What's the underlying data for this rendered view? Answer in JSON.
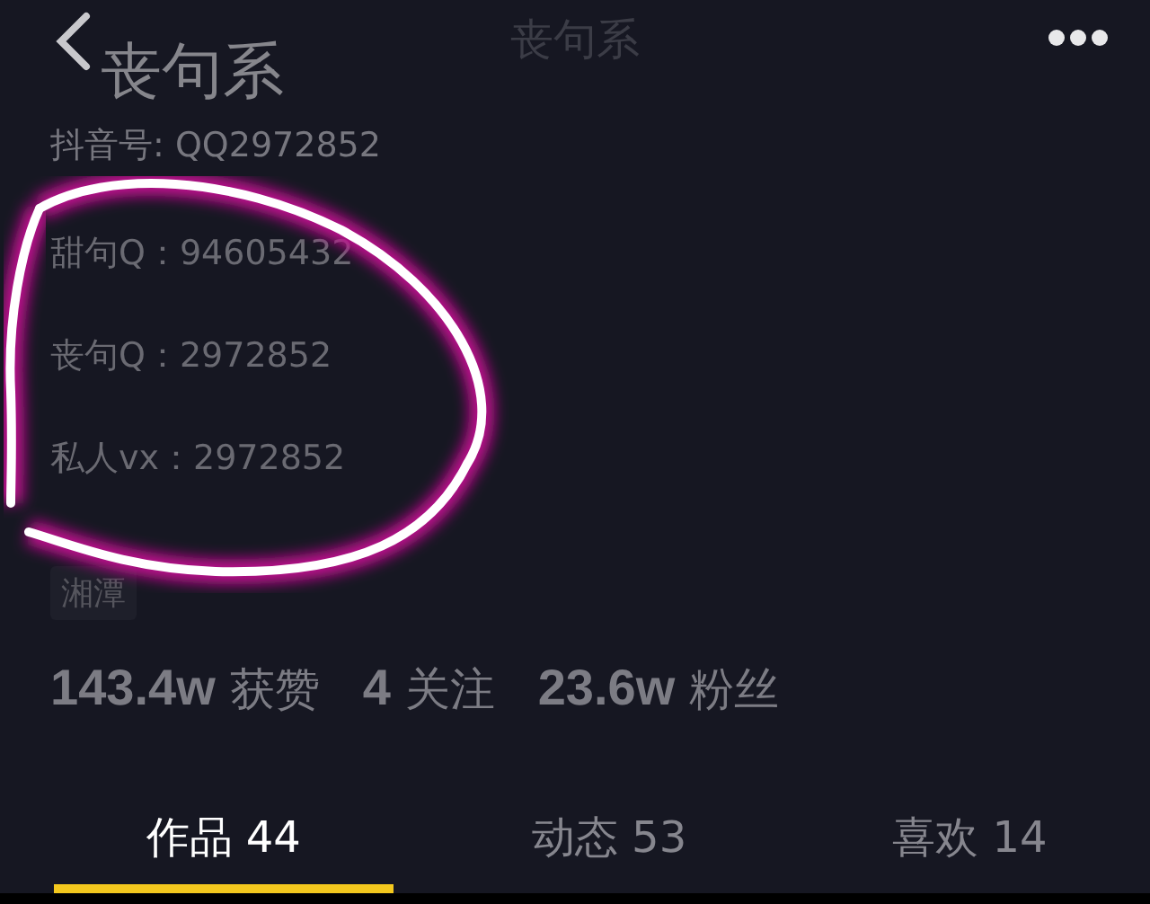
{
  "header": {
    "title": "丧句系"
  },
  "profile": {
    "name": "丧句系",
    "account_id": "抖音号: QQ2972852",
    "bio": [
      "甜句Q：94605432",
      "丧句Q：2972852",
      "私人vx：2972852"
    ],
    "tags": [
      "湘潭"
    ]
  },
  "stats": [
    "**143.4w** 获赞",
    "**4** 关注",
    "**23.6w** 粉丝"
  ],
  "tabs": [
    {
      "label": "作品 44",
      "selected": true
    },
    {
      "label": "动态 53",
      "selected": false
    },
    {
      "label": "喜欢 14",
      "selected": false
    }
  ]
}
